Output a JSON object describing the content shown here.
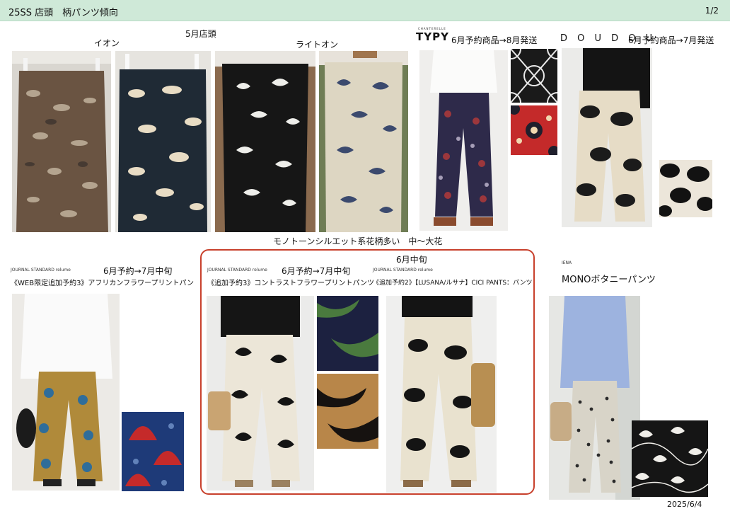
{
  "header": {
    "title": "25SS 店頭　柄パンツ傾向",
    "page": "1/2"
  },
  "labels": {
    "aeon": "イオン",
    "may_store": "5月店頭",
    "lighton": "ライトオン",
    "mono_note": "モノトーンシルエット系花柄多い　中～大花",
    "june_mid": "6月中旬",
    "date": "2025/6/4"
  },
  "typy": {
    "small": "CHANTERELLE",
    "brand": "TYPY",
    "note": "6月予約商品→8月発送"
  },
  "doudou": {
    "brand": "D O U D O U",
    "note": "6月予約商品→7月発送"
  },
  "js_african": {
    "brand": "JOURNAL STANDARD relume",
    "note": "6月予約→7月中旬",
    "product": "《WEB限定追加予約3》アフリカンフラワープリントパン"
  },
  "js_contrast": {
    "brand": "JOURNAL STANDARD relume",
    "note": "6月予約→7月中旬",
    "product": "《追加予約3》コントラストフラワープリントパンツ"
  },
  "js_lusana": {
    "brand": "JOURNAL STANDARD relume",
    "product": "《追加予約2》【LUSANA/ルサナ】CICI PANTS：パンツ"
  },
  "iena": {
    "brand": "IENA",
    "product": "MONOボタニーパンツ"
  }
}
